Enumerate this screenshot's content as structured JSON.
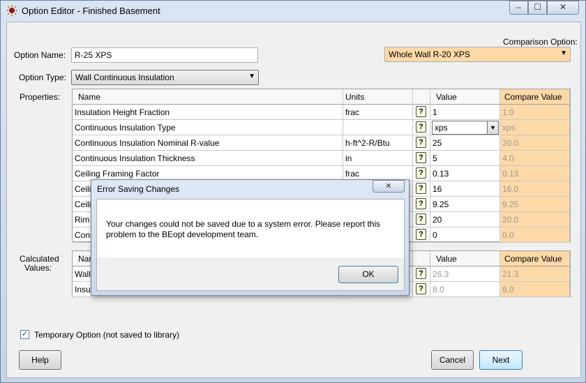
{
  "window": {
    "title": "Option Editor - Finished Basement",
    "min_glyph": "–",
    "max_glyph": "☐",
    "close_glyph": "✕"
  },
  "form": {
    "option_name_label": "Option Name:",
    "option_name_value": "R-25 XPS",
    "option_type_label": "Option Type:",
    "option_type_value": "Wall Continuous Insulation",
    "comparison_label": "Comparison Option:",
    "comparison_value": "Whole Wall R-20 XPS",
    "properties_label": "Properties:",
    "calculated_label_line1": "Calculated",
    "calculated_label_line2": "Values:"
  },
  "properties_table": {
    "headers": {
      "name": "Name",
      "units": "Units",
      "value": "Value",
      "compare": "Compare Value"
    },
    "rows": [
      {
        "name": "Insulation Height Fraction",
        "units": "frac",
        "value": "1",
        "compare": "1.0"
      },
      {
        "name": "Continuous Insulation Type",
        "units": "",
        "value": "xps",
        "compare": "xps"
      },
      {
        "name": "Continuous Insulation Nominal R-value",
        "units": "h-ft^2-R/Btu",
        "value": "25",
        "compare": "20.0"
      },
      {
        "name": "Continuous Insulation Thickness",
        "units": "in",
        "value": "5",
        "compare": "4.0"
      },
      {
        "name": "Ceiling Framing Factor",
        "units": "frac",
        "value": "0.13",
        "compare": "0.13"
      },
      {
        "name": "Ceili",
        "units": "",
        "value": "16",
        "compare": "16.0"
      },
      {
        "name": "Ceili",
        "units": "",
        "value": "9.25",
        "compare": "9.25"
      },
      {
        "name": "Rim J",
        "units": "",
        "value": "20",
        "compare": "20.0"
      },
      {
        "name": "Cons",
        "units": "",
        "value": "0",
        "compare": "0.0"
      }
    ]
  },
  "calculated_table": {
    "headers": {
      "name": "Nam",
      "value": "Value",
      "compare": "Compare Value"
    },
    "rows": [
      {
        "name": "Wall",
        "value": "26.3",
        "compare": "21.3"
      },
      {
        "name": "Insul",
        "value": "8.0",
        "compare": "8.0"
      }
    ]
  },
  "help_glyph": "?",
  "dropdown_glyph": "▼",
  "temporary_option": {
    "label": "Temporary Option (not saved to library)",
    "checked": "✓"
  },
  "buttons": {
    "help": "Help",
    "cancel": "Cancel",
    "next": "Next"
  },
  "dialog": {
    "title": "Error Saving Changes",
    "close_glyph": "✕",
    "message": "Your changes could not be saved due to a system error.  Please report this problem to the BEopt development team.",
    "ok": "OK"
  }
}
